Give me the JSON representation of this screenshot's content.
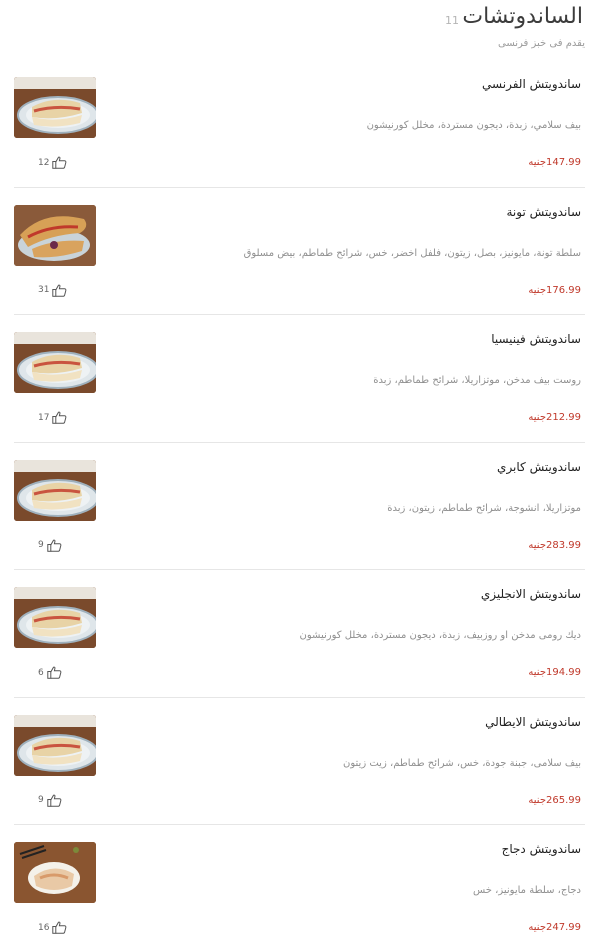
{
  "header": {
    "title": "الساندوتشات",
    "count": "11",
    "subtitle": "يقدم فى خبز فرنسى"
  },
  "items": [
    {
      "name": "ساندويتش الفرنسي",
      "description": "بيف سلامي، زبدة، ديجون مستردة، مخلل كورنيشون",
      "price": "147.99جنيه",
      "likes": "12",
      "image": "sandwich-plate"
    },
    {
      "name": "ساندويتش تونة",
      "description": "سلطة تونة، مايونيز، بصل، زيتون، فلفل اخضر، خس، شرائح طماطم، بيض مسلوق",
      "price": "176.99جنيه",
      "likes": "31",
      "image": "sandwich-tuna"
    },
    {
      "name": "ساندويتش فينيسيا",
      "description": "روست بيف مدخن، موتزاريلا، شرائح طماطم، زبدة",
      "price": "212.99جنيه",
      "likes": "17",
      "image": "sandwich-plate"
    },
    {
      "name": "ساندويتش كابري",
      "description": "موتزاريلا، انشوجة، شرائح طماطم، زيتون، زبدة",
      "price": "283.99جنيه",
      "likes": "9",
      "image": "sandwich-plate"
    },
    {
      "name": "ساندويتش الانجليزي",
      "description": "ديك رومى مدخن او روزبيف، زبدة، ديجون مستردة، مخلل كورنيشون",
      "price": "194.99جنيه",
      "likes": "6",
      "image": "sandwich-plate"
    },
    {
      "name": "ساندويتش الايطالي",
      "description": "بيف سلامى، جبنة جودة، خس، شرائح طماطم، زيت زيتون",
      "price": "265.99جنيه",
      "likes": "9",
      "image": "sandwich-plate"
    },
    {
      "name": "ساندويتش دجاج",
      "description": "دجاج، سلطة مايونيز، خس",
      "price": "247.99جنيه",
      "likes": "16",
      "image": "sandwich-chicken"
    }
  ],
  "colors": {
    "price": "#c0392b",
    "divider": "#e6e6e6",
    "text": "#222222",
    "muted": "#8f8f8f"
  }
}
